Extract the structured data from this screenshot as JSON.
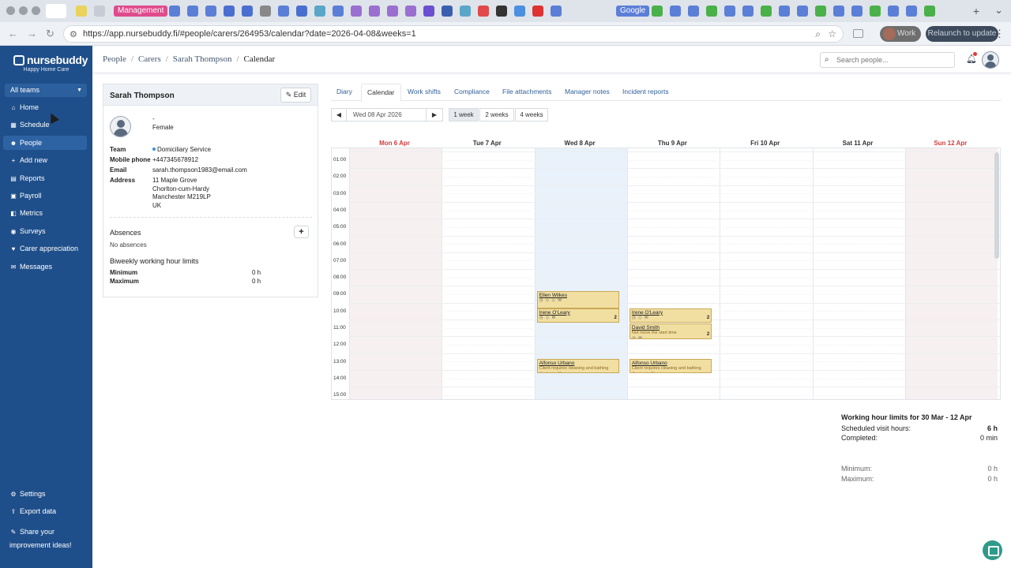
{
  "browser": {
    "url": "https://app.nursebuddy.fi/#people/carers/264953/calendar?date=2026-04-08&weeks=1",
    "tab_management": "Management",
    "tab_google": "Google",
    "work_label": "Work",
    "relaunch_label": "Relaunch to update"
  },
  "app": {
    "logo": "nursebuddy",
    "org": "Happy Home Care",
    "team_select": "All teams"
  },
  "sidebar": {
    "items": [
      {
        "label": "Home",
        "icon": "home-icon",
        "glyph": "⌂"
      },
      {
        "label": "Schedule",
        "icon": "calendar-icon",
        "glyph": "▦"
      },
      {
        "label": "People",
        "icon": "person-icon",
        "glyph": "☻"
      },
      {
        "label": "Add new",
        "icon": "plus-icon",
        "glyph": "+"
      },
      {
        "label": "Reports",
        "icon": "report-icon",
        "glyph": "▤"
      },
      {
        "label": "Payroll",
        "icon": "wallet-icon",
        "glyph": "▣"
      },
      {
        "label": "Metrics",
        "icon": "chart-icon",
        "glyph": "◧"
      },
      {
        "label": "Surveys",
        "icon": "survey-icon",
        "glyph": "◉"
      },
      {
        "label": "Carer appreciation",
        "icon": "heart-icon",
        "glyph": "♥"
      },
      {
        "label": "Messages",
        "icon": "message-icon",
        "glyph": "✉"
      }
    ],
    "settings": "Settings",
    "export": "Export data",
    "share_ideas": "Share your improvement ideas!"
  },
  "header": {
    "breadcrumb": [
      "People",
      "Carers",
      "Sarah Thompson",
      "Calendar"
    ],
    "search_placeholder": "Search people..."
  },
  "profile": {
    "name": "Sarah Thompson",
    "edit_label": "Edit",
    "dash": "-",
    "gender": "Female",
    "team_label": "Team",
    "team_value": "Domiciliary Service",
    "phone_label": "Mobile phone",
    "phone_value": "+447345678912",
    "email_label": "Email",
    "email_value": "sarah.thompson1983@email.com",
    "address_label": "Address",
    "address_lines": [
      "11 Maple Grove",
      "Chorlton-cum-Hardy",
      "Manchester M219LP",
      "UK"
    ],
    "absences_title": "Absences",
    "no_absences": "No absences",
    "limits_title": "Biweekly working hour limits",
    "minimum_label": "Minimum",
    "minimum_value": "0 h",
    "maximum_label": "Maximum",
    "maximum_value": "0 h"
  },
  "tabs": [
    "Diary",
    "Calendar",
    "Work shifts",
    "Compliance",
    "File attachments",
    "Manager notes",
    "Incident reports"
  ],
  "active_tab": "Calendar",
  "date_controls": {
    "current": "Wed 08 Apr 2026",
    "ranges": [
      "1 week",
      "2 weeks",
      "4 weeks"
    ],
    "active_range": "1 week"
  },
  "calendar": {
    "days": [
      {
        "label": "Mon 6 Apr",
        "weekend": true
      },
      {
        "label": "Tue 7 Apr",
        "weekend": false
      },
      {
        "label": "Wed 8 Apr",
        "weekend": false,
        "today": true
      },
      {
        "label": "Thu 9 Apr",
        "weekend": false
      },
      {
        "label": "Fri 10 Apr",
        "weekend": false
      },
      {
        "label": "Sat 11 Apr",
        "weekend": false
      },
      {
        "label": "Sun 12 Apr",
        "weekend": true
      }
    ],
    "hours": [
      "01:00",
      "02:00",
      "03:00",
      "04:00",
      "05:00",
      "06:00",
      "07:00",
      "08:00",
      "09:00",
      "10:00",
      "11:00",
      "12:00",
      "13:00",
      "14:00",
      "15:00"
    ],
    "visits": [
      {
        "day": 2,
        "start": 9.0,
        "end": 10.0,
        "name": "Ellen Wilkes",
        "note": "",
        "icons": "◷ ◇ ◇ ✉",
        "count": ""
      },
      {
        "day": 2,
        "start": 10.0,
        "end": 10.85,
        "name": "Irene O'Leary",
        "note": "",
        "icons": "◷ ◇ ✉",
        "count": "2"
      },
      {
        "day": 3,
        "start": 10.0,
        "end": 10.85,
        "name": "Irene O'Leary",
        "note": "",
        "icons": "◷ ◇ ✉",
        "count": "2"
      },
      {
        "day": 3,
        "start": 10.9,
        "end": 11.85,
        "name": "David Smith",
        "note": "Not move the start time",
        "icons": "◷ ✉",
        "count": "2"
      },
      {
        "day": 2,
        "start": 13.0,
        "end": 13.85,
        "name": "Alfonso Urbano",
        "note": "Client requires cleaning and bathing",
        "icons": "◷ ◇ ◇ ✉",
        "count": ""
      },
      {
        "day": 3,
        "start": 13.0,
        "end": 13.85,
        "name": "Alfonso Urbano",
        "note": "Client requires cleaning and bathing",
        "icons": "◷ ◇ ◇ ✉",
        "count": ""
      }
    ]
  },
  "summary": {
    "title": "Working hour limits for 30 Mar - 12 Apr",
    "scheduled_label": "Scheduled visit hours:",
    "scheduled_value": "6 h",
    "completed_label": "Completed:",
    "completed_value": "0 min",
    "minimum_label": "Minimum:",
    "minimum_value": "0 h",
    "maximum_label": "Maximum:",
    "maximum_value": "0 h"
  },
  "colors": {
    "sidebar": "#1f4f8a",
    "visit_fill": "#f1dfa2",
    "weekend_text": "#d43c3c",
    "management_tab": "#e04a8c"
  }
}
